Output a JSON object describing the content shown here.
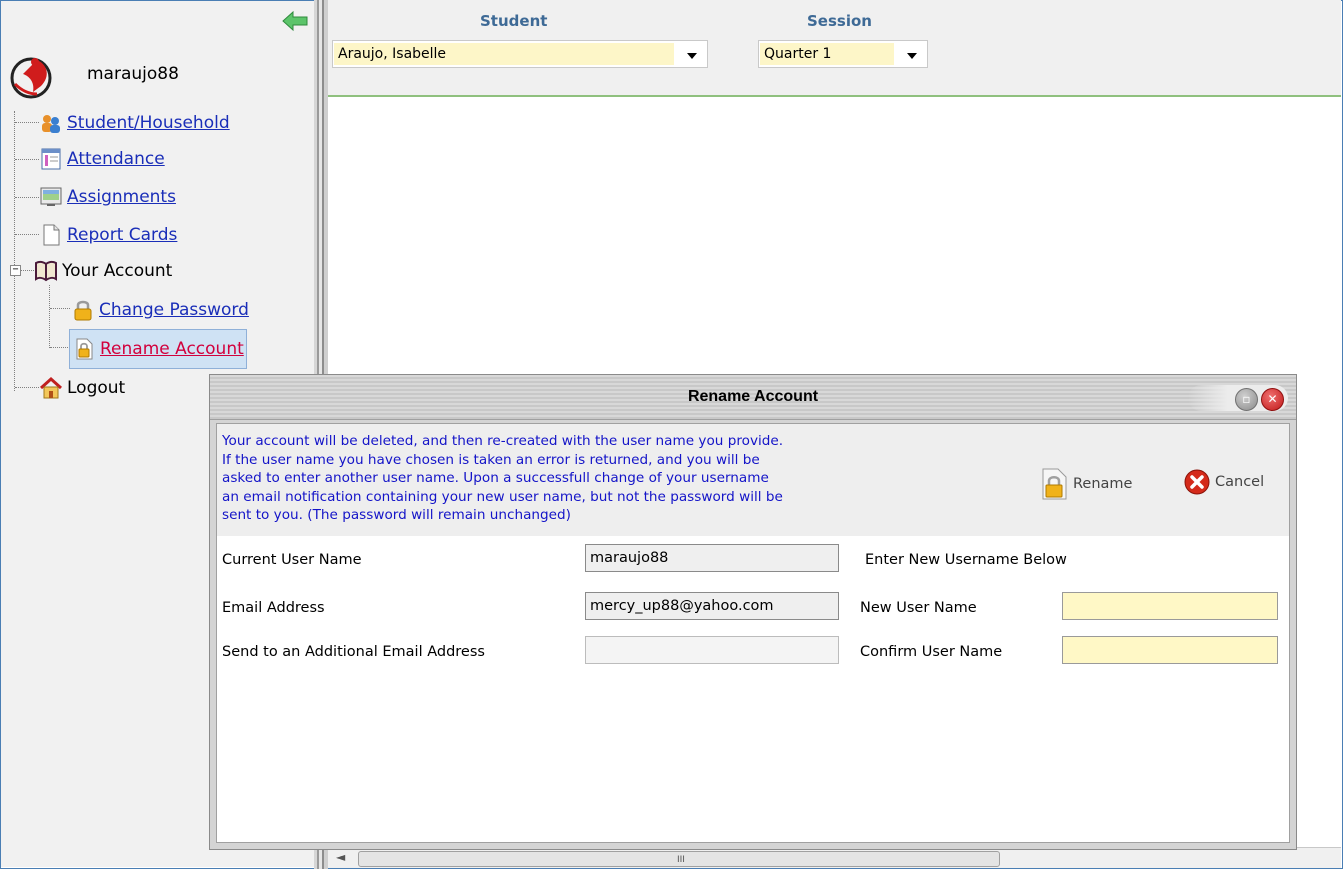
{
  "sidebar": {
    "username": "maraujo88",
    "items": [
      {
        "label": "Student/Household",
        "icon": "household-icon"
      },
      {
        "label": "Attendance",
        "icon": "attendance-icon"
      },
      {
        "label": "Assignments",
        "icon": "assignments-icon"
      },
      {
        "label": "Report Cards",
        "icon": "report-cards-icon"
      },
      {
        "label": "Your Account",
        "icon": "book-icon"
      },
      {
        "label": "Change Password",
        "icon": "lock-icon"
      },
      {
        "label": "Rename Account",
        "icon": "lock-doc-icon"
      },
      {
        "label": "Logout",
        "icon": "home-icon"
      }
    ],
    "expander": "−"
  },
  "topbar": {
    "student_label": "Student",
    "student_value": "Araujo, Isabelle",
    "session_label": "Session",
    "session_value": "Quarter 1"
  },
  "scrollbar": {
    "grip": "III",
    "left_arrow": "◄"
  },
  "modal": {
    "title": "Rename Account",
    "info_lines": [
      "Your account will be deleted, and then re-created with the user name you provide.",
      "If the user name you have chosen is taken an error is returned, and you will be",
      "asked to enter another user name. Upon a successfull change of your username",
      "an email notification containing your new user name, but not the password will be",
      "sent to you. (The password will remain unchanged)"
    ],
    "rename_label": "Rename",
    "cancel_label": "Cancel",
    "fields": {
      "current_user_name_label": "Current User Name",
      "current_user_name_value": "maraujo88",
      "email_label": "Email Address",
      "email_value": "mercy_up88@yahoo.com",
      "additional_email_label": "Send to an Additional Email Address",
      "additional_email_value": "",
      "enter_new_heading": "Enter New Username Below",
      "new_user_name_label": "New User Name",
      "new_user_name_value": "",
      "confirm_user_name_label": "Confirm User Name",
      "confirm_user_name_value": ""
    }
  },
  "colors": {
    "link": "#1a2eb8",
    "active_link": "#d2003c",
    "info_text": "#1414c8",
    "input_highlight": "#fff8c6",
    "frame_border": "#4a7eb4",
    "topbar_divider": "#8fc07e"
  }
}
